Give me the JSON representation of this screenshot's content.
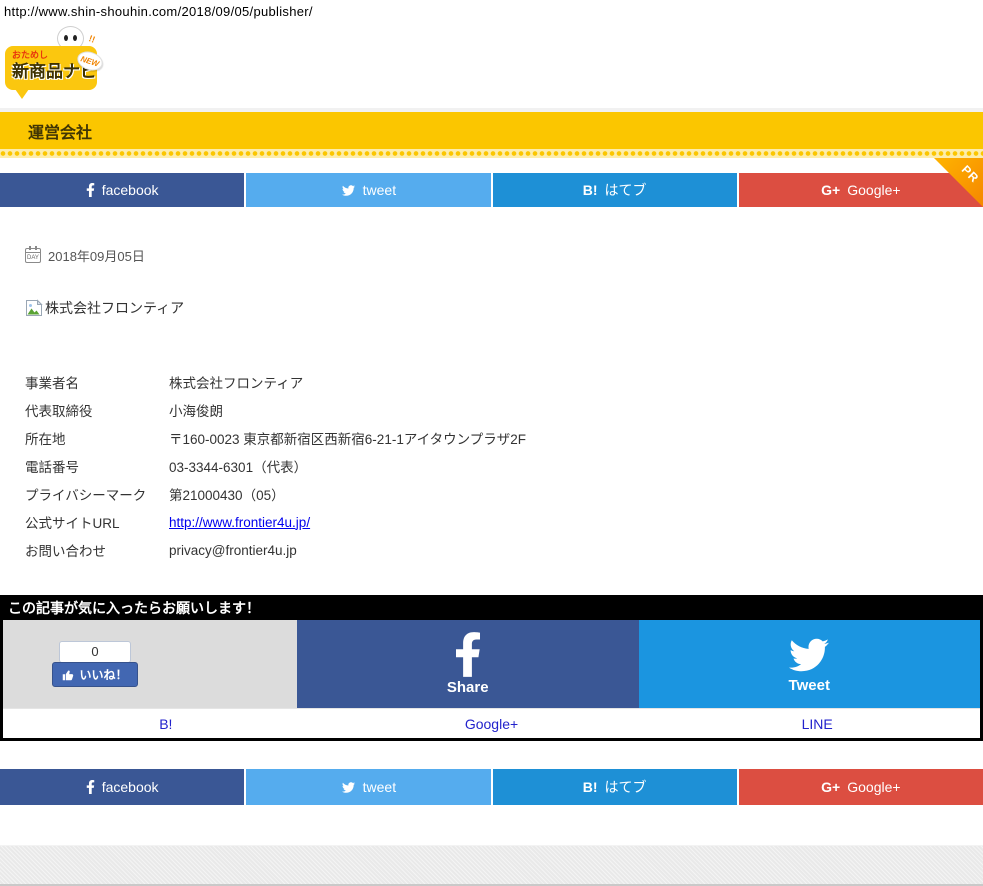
{
  "page": {
    "url": "http://www.shin-shouhin.com/2018/09/05/publisher/",
    "title": "運営会社"
  },
  "logo": {
    "tagline": "おためし",
    "name": "新商品ナビ",
    "badge": "NEW"
  },
  "share_bar": {
    "facebook_label": "facebook",
    "tweet_label": "tweet",
    "hatena_glyph": "B!",
    "hatena_label": "はてブ",
    "gplus_glyph": "G+",
    "gplus_label": "Google+",
    "pr_label": "PR"
  },
  "article": {
    "date": "2018年09月05日",
    "date_icon_text": "DAY",
    "image_alt": "株式会社フロンティア",
    "company": {
      "rows": [
        {
          "label": "事業者名",
          "value": "株式会社フロンティア"
        },
        {
          "label": "代表取締役",
          "value": "小海俊朗"
        },
        {
          "label": "所在地",
          "value": "〒160-0023 東京都新宿区西新宿6-21-1アイタウンプラザ2F"
        },
        {
          "label": "電話番号",
          "value": "03-3344-6301（代表）"
        },
        {
          "label": "プライバシーマーク",
          "value": "第21000430（05）"
        },
        {
          "label": "公式サイトURL",
          "value": "http://www.frontier4u.jp/"
        },
        {
          "label": "お問い合わせ",
          "value": "privacy@frontier4u.jp"
        }
      ]
    }
  },
  "cta": {
    "message": "この記事が気に入ったらお願いします！"
  },
  "share_box": {
    "like_count": "0",
    "like_label": "いいね！",
    "fb_glyph_note": "facebook-f",
    "fb_share_label": "Share",
    "tweet_label": "Tweet",
    "links": [
      "B!",
      "Google+",
      "LINE"
    ]
  },
  "colors": {
    "facebook_blue": "#3a5795",
    "twitter_blue": "#55acee",
    "tweet_panel_blue": "#1b95e0",
    "hatena_blue": "#1e90d6",
    "gplus_red": "#dc4e41",
    "brand_yellow": "#fbc600",
    "pr_orange": "#f68b00",
    "link_blue": "#0000ee",
    "cta_black": "#000000",
    "footer_gray": "#e9e9e9"
  }
}
